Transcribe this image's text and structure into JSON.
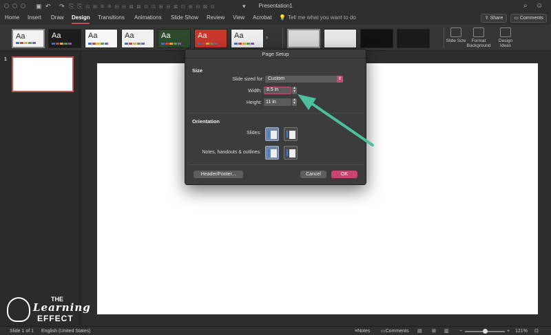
{
  "window": {
    "title": "Presentation1"
  },
  "tabs": [
    "Home",
    "Insert",
    "Draw",
    "Design",
    "Transitions",
    "Animations",
    "Slide Show",
    "Review",
    "View",
    "Acrobat"
  ],
  "active_tab": "Design",
  "tell_me": "Tell me what you want to do",
  "header_buttons": {
    "share": "Share",
    "comments": "Comments"
  },
  "themes": [
    {
      "label": "Aa",
      "bg": "#f2f2f2",
      "fg": "#222222"
    },
    {
      "label": "Aa",
      "bg": "#1c1c1c",
      "fg": "#ffffff"
    },
    {
      "label": "Aa",
      "bg": "#f7f7f7",
      "fg": "#222222"
    },
    {
      "label": "Aa",
      "bg": "#f0f0f0",
      "fg": "#222222"
    },
    {
      "label": "Aa",
      "bg": "#2d4a2d",
      "fg": "#ffffff"
    },
    {
      "label": "Aa",
      "bg": "#c9372c",
      "fg": "#ffffff"
    },
    {
      "label": "Aa",
      "bg": "#eeeeee",
      "fg": "#222222"
    }
  ],
  "variants": [
    {
      "bg": "#d8d8d8"
    },
    {
      "bg": "#e6e6e6"
    },
    {
      "bg": "#111111"
    },
    {
      "bg": "#1a1a1a"
    }
  ],
  "ribbon_tools": {
    "slide_size": "Slide Size",
    "format_background": "Format Background",
    "design_ideas": "Design Ideas"
  },
  "thumbnail": {
    "number": "1"
  },
  "dialog": {
    "title": "Page Setup",
    "size_heading": "Size",
    "slide_sized_for_label": "Slide sized for:",
    "slide_sized_for_value": "Custom",
    "width_label": "Width:",
    "width_value": "8.5 in",
    "height_label": "Height:",
    "height_value": "11 in",
    "orientation_heading": "Orientation",
    "slides_label": "Slides:",
    "notes_label": "Notes, handouts & outlines:",
    "header_footer_button": "Header/Footer...",
    "cancel_button": "Cancel",
    "ok_button": "OK"
  },
  "logo": {
    "line1": "THE",
    "line2": "Learning",
    "line3": "EFFECT"
  },
  "status": {
    "slide_info": "Slide 1 of 1",
    "language": "English (United States)",
    "notes": "Notes",
    "comments": "Comments",
    "zoom_percent": "121%",
    "zoom_fraction": 0.5
  },
  "colors": {
    "accent": "#c9456f",
    "arrow": "#4bbf9f",
    "thumb_border": "#c0574e"
  }
}
